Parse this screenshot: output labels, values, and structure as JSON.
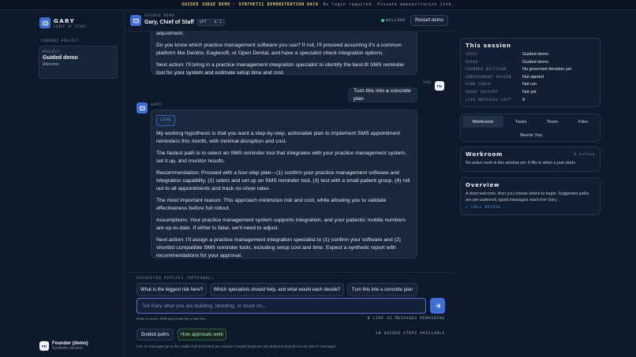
{
  "banner": {
    "title": "GUIDED JUDGE DEMO · SYNTHETIC DEMONSTRATION DATA",
    "note": "No login required. Private demonstration link."
  },
  "sidebar": {
    "brand_name": "GARY",
    "brand_sub": "CHIEF OF STAFF",
    "current_project_label": "CURRENT PROJECT",
    "project": {
      "label": "PROJECT",
      "name": "Guided demo",
      "sub": "Welcome"
    },
    "founder": {
      "initials": "FD",
      "name": "Founder (demo)",
      "sub": "Synthetic session"
    }
  },
  "header": {
    "label": "GUIDED DEMO",
    "title": "Gary, Chief of Staff",
    "model": "GPT · 4.1",
    "status": "WELCOME",
    "restart_label": "Restart demo"
  },
  "chat": {
    "prev_message": [
      "adjustment.",
      "Do you know which practice management software you use? If not, I'll proceed assuming it's a common platform like Dentrix, Eaglesoft, or Open Dental, and have a specialist check integration options.",
      "Next action: I'll bring in a practice management integration specialist to identify the best-fit SMS reminder tool for your system and estimate setup time and cost."
    ],
    "you_label": "YOU",
    "user_initials": "FD",
    "user_message": "Turn this into a concrete plan",
    "gary_label": "GARY",
    "live_badge": "LIVE",
    "reply": [
      "My working hypothesis is that you want a step-by-step, actionable plan to implement SMS appointment reminders this month, with minimal disruption and cost.",
      "The fastest path is to select an SMS reminder tool that integrates with your practice management system, set it up, and monitor results.",
      "Recommendation: Proceed with a four-step plan—(1) confirm your practice management software and integration capability, (2) select and set up an SMS reminder tool, (3) test with a small patient group, (4) roll out to all appointments and track no-show rates.",
      "The most important reason: This approach minimizes risk and cost, while allowing you to validate effectiveness before full rollout.",
      "Assumptions: Your practice management system supports integration, and your patients' mobile numbers are up-to-date. If either is false, we'll need to adjust.",
      "Next action: I'll assign a practice management integration specialist to (1) confirm your software and (2) shortlist compatible SMS reminder tools, including setup cost and time. Expect a synthetic report with recommendations for your approval."
    ]
  },
  "composer": {
    "suggested_label": "SUGGESTED REPLIES (OPTIONAL)",
    "suggestions": [
      "What is the biggest risk here?",
      "Which specialists should help, and what would each decide?",
      "Turn this into a concrete plan"
    ],
    "placeholder": "Tell Gary what you are building, deciding, or stuck on...",
    "hint": "Enter to send. Shift plus Enter for a new line.",
    "remaining": "8 LIVE AI MESSAGES REMAINING",
    "guided_paths_label": "Guided paths",
    "approvals_label": "How approvals work",
    "steps": "10 GUIDED STEPS AVAILABLE",
    "footnote": "Live AI messages go to the model and are limited per session. Guided steps are pre-authored and do not use live AI messages."
  },
  "session": {
    "title": "This session",
    "rows": [
      {
        "k": "TOPIC",
        "v": "Guided demo"
      },
      {
        "k": "PHASE",
        "v": "Guided demo"
      },
      {
        "k": "FOUNDER DECISION",
        "v": "No governed decision yet"
      },
      {
        "k": "INDEPENDENT REVIEW",
        "v": "Not started"
      },
      {
        "k": "VIBE CHECK",
        "v": "Not run"
      },
      {
        "k": "PROOF RECEIPT",
        "v": "Not yet"
      },
      {
        "k": "LIVE MESSAGES LEFT",
        "v": "8"
      }
    ]
  },
  "tabs": {
    "workroom": "Workroom",
    "tasks": "Tasks",
    "team": "Team",
    "files": "Files",
    "needs_you": "Needs You"
  },
  "workroom": {
    "title": "Workroom",
    "tag": "0 active",
    "body": "No active work in this window yet. It fills in when a pod starts."
  },
  "overview": {
    "title": "Overview",
    "body": "A short welcome, then you choose where to begin. Suggested paths are pre-authored; typed messages reach live Gary.",
    "link": "▸ FULL DETAIL"
  },
  "colors": {
    "accent": "#3f6fd6",
    "background": "#0e1a2b",
    "live_green": "#3ccf7d"
  }
}
